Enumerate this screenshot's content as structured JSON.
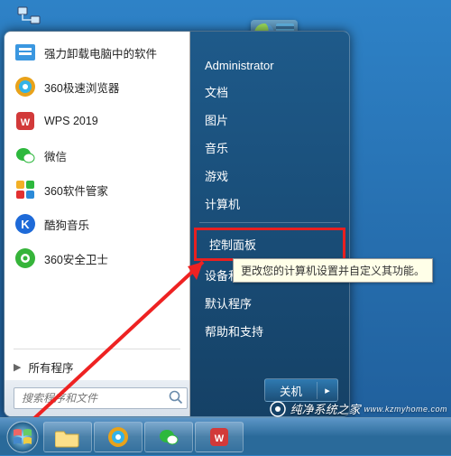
{
  "desktop": {
    "label": "网络"
  },
  "start_menu": {
    "programs": [
      {
        "label": "强力卸载电脑中的软件",
        "color": "#3a97e0"
      },
      {
        "label": "360极速浏览器",
        "color_outer": "#e8a21a",
        "color_inner": "#34b3e8"
      },
      {
        "label": "WPS 2019",
        "color": "#d23a3a"
      },
      {
        "label": "微信",
        "color": "#2db83d"
      },
      {
        "label": "360软件管家",
        "color_a": "#f2b026",
        "color_b": "#2db83d",
        "color_c": "#e23030",
        "color_d": "#2b8ad8"
      },
      {
        "label": "酷狗音乐",
        "color": "#1e6ad8"
      },
      {
        "label": "360安全卫士",
        "color": "#36b43a"
      }
    ],
    "all_programs": "所有程序",
    "search_placeholder": "搜索程序和文件",
    "right_items": [
      "Administrator",
      "文档",
      "图片",
      "音乐",
      "游戏",
      "计算机",
      "控制面板",
      "设备和打印机",
      "默认程序",
      "帮助和支持"
    ],
    "shutdown_label": "关机"
  },
  "tooltip": "更改您的计算机设置并自定义其功能。",
  "watermark": {
    "text": "纯净系统之家",
    "sub": "www.kzmyhome.com"
  }
}
